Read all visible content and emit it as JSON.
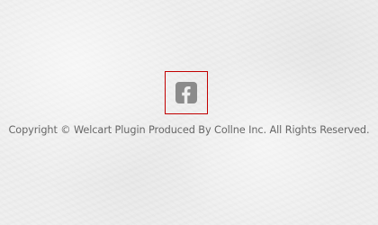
{
  "footer": {
    "social": {
      "icon": "facebook-icon",
      "icon_color": "#8b8b8b",
      "focus_outline_color": "#c20000"
    },
    "copyright": "Copyright © Welcart Plugin Produced By Collne Inc. All Rights Reserved."
  }
}
